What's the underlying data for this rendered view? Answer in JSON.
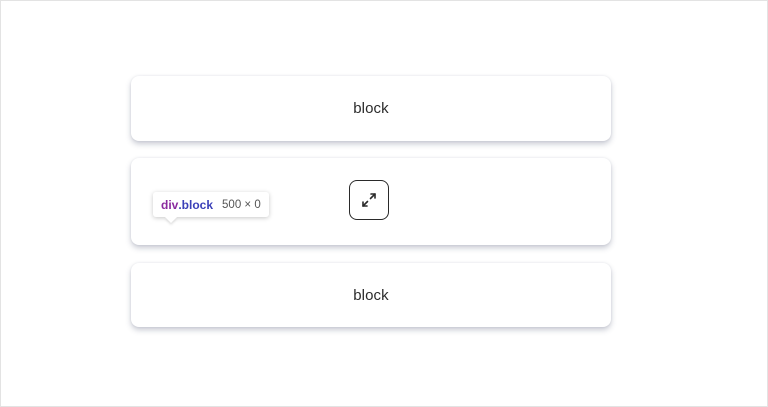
{
  "blocks": [
    {
      "label": "block"
    },
    {
      "label": ""
    },
    {
      "label": "block"
    }
  ],
  "expand_button": {
    "icon": "expand-arrows-icon"
  },
  "inspector_tooltip": {
    "tag": "div",
    "class_name": ".block",
    "dimensions": "500 × 0"
  }
}
